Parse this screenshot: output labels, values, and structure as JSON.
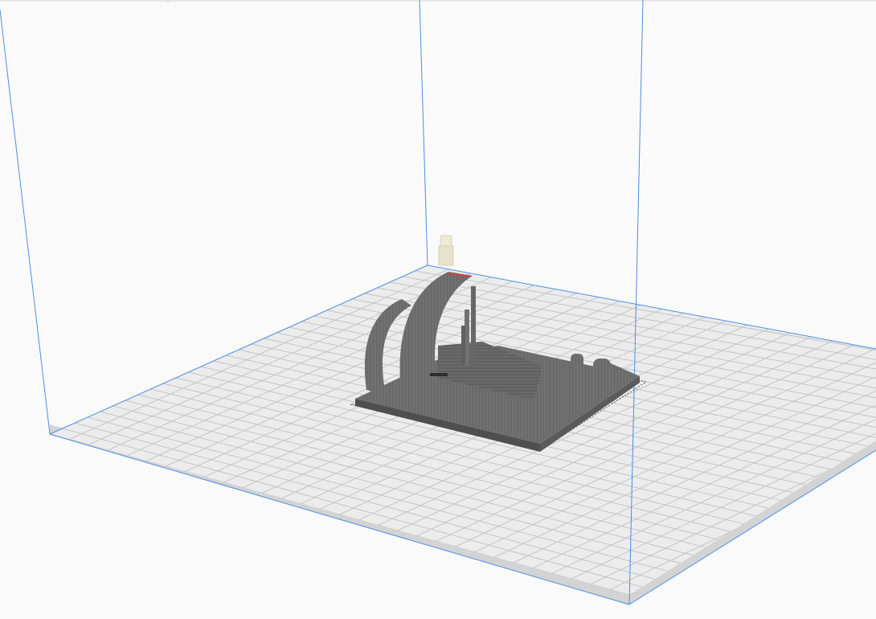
{
  "scene": {
    "view": "3d-build-volume",
    "background_color": "#fafafa",
    "plate_color": "#ececec",
    "plate_edge_color": "#d2d2d2",
    "grid_color": "#c4c4c4",
    "volume_outline_color": "#4a8ee6",
    "model_color": "#6e6e6e",
    "model_shadow_color": "#4f4f4f",
    "support_color": "#eee9d8",
    "highlight_color": "#d94040",
    "grid_lines": 30
  }
}
